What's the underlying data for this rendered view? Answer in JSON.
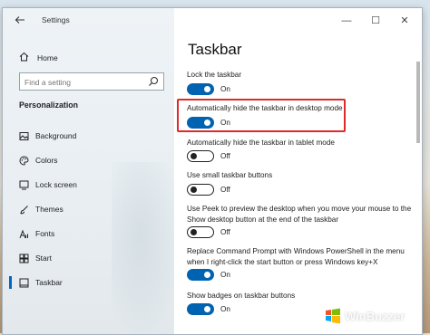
{
  "window": {
    "title": "Settings",
    "controls": {
      "minimize": "—",
      "maximize": "☐",
      "close": "✕"
    }
  },
  "sidebar": {
    "home_label": "Home",
    "search_placeholder": "Find a setting",
    "section_title": "Personalization",
    "items": [
      {
        "label": "Background",
        "icon": "image-icon"
      },
      {
        "label": "Colors",
        "icon": "palette-icon"
      },
      {
        "label": "Lock screen",
        "icon": "lock-screen-icon"
      },
      {
        "label": "Themes",
        "icon": "brush-icon"
      },
      {
        "label": "Fonts",
        "icon": "font-icon"
      },
      {
        "label": "Start",
        "icon": "start-icon"
      },
      {
        "label": "Taskbar",
        "icon": "taskbar-icon",
        "active": true
      }
    ]
  },
  "main": {
    "title": "Taskbar",
    "settings": [
      {
        "label": "Lock the taskbar",
        "state": "On"
      },
      {
        "label": "Automatically hide the taskbar in desktop mode",
        "state": "On",
        "highlighted": true
      },
      {
        "label": "Automatically hide the taskbar in tablet mode",
        "state": "Off"
      },
      {
        "label": "Use small taskbar buttons",
        "state": "Off"
      },
      {
        "label": "Use Peek to preview the desktop when you move your mouse to the Show desktop button at the end of the taskbar",
        "state": "Off"
      },
      {
        "label": "Replace Command Prompt with Windows PowerShell in the menu when I right-click the start button or press Windows key+X",
        "state": "On"
      },
      {
        "label": "Show badges on taskbar buttons",
        "state": "On"
      }
    ]
  },
  "watermark": {
    "text": "WinBuzzer"
  },
  "colors": {
    "accent": "#0063b1",
    "highlight": "#e02a2a"
  }
}
